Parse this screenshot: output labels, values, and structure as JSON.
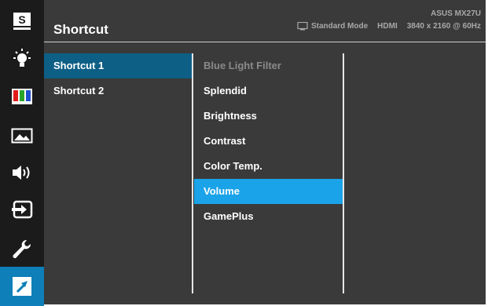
{
  "header": {
    "title": "Shortcut",
    "model": "ASUS MX27U",
    "mode": "Standard Mode",
    "input": "HDMI",
    "resolution": "3840 x 2160 @ 60Hz"
  },
  "rail": {
    "items": [
      {
        "icon": "splendid-s-icon",
        "label": "S"
      },
      {
        "icon": "blue-light-filter-icon"
      },
      {
        "icon": "color-bars-icon"
      },
      {
        "icon": "image-icon"
      },
      {
        "icon": "sound-icon"
      },
      {
        "icon": "input-select-icon"
      },
      {
        "icon": "system-setup-wrench-icon"
      },
      {
        "icon": "shortcut-arrow-icon",
        "active": true
      }
    ]
  },
  "menu": {
    "level1": [
      {
        "label": "Shortcut 1",
        "selected": true
      },
      {
        "label": "Shortcut 2"
      }
    ],
    "level2": [
      {
        "label": "Blue Light Filter",
        "disabled": true
      },
      {
        "label": "Splendid"
      },
      {
        "label": "Brightness"
      },
      {
        "label": "Contrast"
      },
      {
        "label": "Color Temp."
      },
      {
        "label": "Volume",
        "highlighted": true
      },
      {
        "label": "GamePlus"
      }
    ]
  },
  "colors": {
    "rail_bg": "#1b1b1b",
    "panel_bg": "#3a3a3a",
    "active_icon_bg": "#0e7fb8",
    "selected_row": "#0e5f86",
    "highlight_row": "#1aa3e8"
  }
}
